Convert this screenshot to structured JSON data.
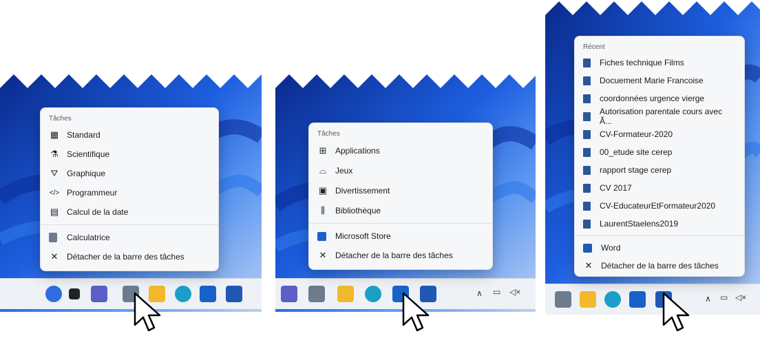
{
  "panel1": {
    "menu": {
      "header": "Tâches",
      "items": [
        "Standard",
        "Scientifique",
        "Graphique",
        "Programmeur",
        "Calcul de la date"
      ],
      "app_label": "Calculatrice",
      "unpin_label": "Détacher de la barre des tâches"
    }
  },
  "panel2": {
    "menu": {
      "header": "Tâches",
      "items": [
        "Applications",
        "Jeux",
        "Divertissement",
        "Bibliothèque"
      ],
      "app_label": "Microsoft Store",
      "unpin_label": "Détacher de la barre des tâches"
    }
  },
  "panel3": {
    "menu": {
      "header": "Récent",
      "items": [
        "Fiches technique Films",
        "Docuement Marie Francoise",
        "coordonnées urgence vierge",
        "Autorisation parentale cours avec Ã...",
        "CV-Formateur-2020",
        "00_etude site cerep",
        "rapport stage cerep",
        "CV 2017",
        "CV-EducateurEtFormateur2020",
        "LaurentStaelens2019"
      ],
      "app_label": "Word",
      "unpin_label": "Détacher de la barre des tâches"
    }
  }
}
